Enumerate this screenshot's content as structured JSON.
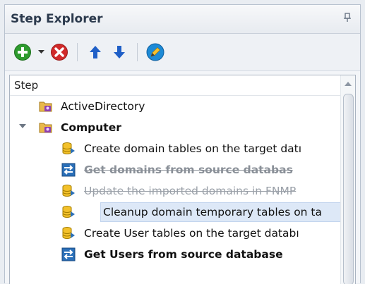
{
  "panel": {
    "title": "Step Explorer",
    "pin_icon": "pin-icon"
  },
  "toolbar": {
    "add_icon": "add-icon",
    "dropdown_icon": "dropdown-arrow-icon",
    "remove_icon": "remove-icon",
    "move_up_icon": "arrow-up-icon",
    "move_down_icon": "arrow-down-icon",
    "edit_icon": "edit-pencil-icon"
  },
  "list": {
    "column_header": "Step",
    "rows": [
      {
        "label": "ActiveDirectory",
        "icon": "folder-icon",
        "style": "normal"
      },
      {
        "label": "Computer",
        "icon": "folder-icon",
        "style": "bold",
        "expanded": true
      },
      {
        "label": "Create domain tables on the target datı",
        "icon": "database-icon",
        "style": "normal"
      },
      {
        "label": "Get domains from source databas",
        "icon": "transfer-icon",
        "style": "bold-strike"
      },
      {
        "label": "Update the imported domains in FNMP",
        "icon": "database-icon",
        "style": "strike"
      },
      {
        "label": "Cleanup domain temporary tables on ta",
        "icon": "database-icon",
        "style": "selected"
      },
      {
        "label": "Create User tables on the target databı",
        "icon": "database-icon",
        "style": "normal"
      },
      {
        "label": "Get Users from source database",
        "icon": "transfer-icon",
        "style": "bold"
      }
    ]
  },
  "colors": {
    "add_green": "#2e9b2e",
    "remove_red": "#d12a2a",
    "arrow_blue": "#1f5fc7",
    "selection": "#dde8f7",
    "folder_yellow": "#e9b84a",
    "folder_purple": "#8e3fb0",
    "database_yellow": "#f3c12b",
    "transfer_blue": "#2a6fb8"
  }
}
